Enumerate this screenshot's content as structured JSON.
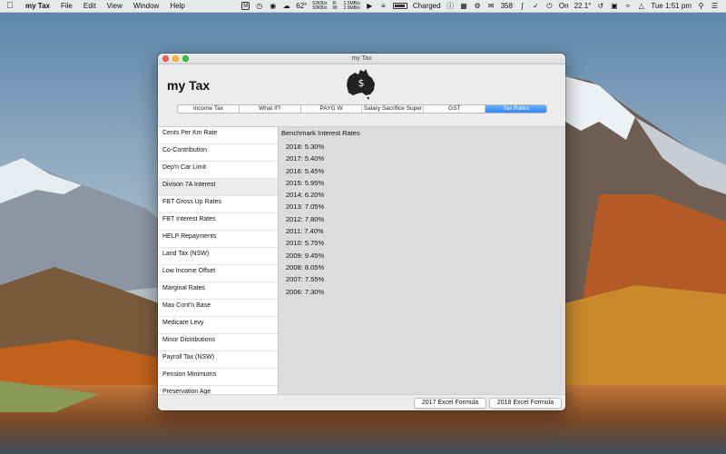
{
  "menubar": {
    "app_name": "my Tax",
    "menus": [
      "File",
      "Edit",
      "View",
      "Window",
      "Help"
    ],
    "temperature": "62°",
    "net_up": "52KB/s",
    "net_down": "50KB/s",
    "net_r_label": "R:",
    "net_w_label": "W:",
    "disk_r": "1.5MB/s",
    "disk_w": "2.9MB/s",
    "battery_status": "Charged",
    "mail_count": "358",
    "on_label": "On",
    "cpu_temp": "22.1°",
    "clock": "Tue 1:51 pm"
  },
  "window": {
    "title": "my Tax",
    "app_heading": "my Tax",
    "logo_symbol": "$",
    "tabs": [
      {
        "label": "Income Tax",
        "active": false
      },
      {
        "label": "What If?",
        "active": false
      },
      {
        "label": "PAYG W",
        "active": false
      },
      {
        "label": "Salary Sacrifice Super",
        "active": false
      },
      {
        "label": "GST",
        "active": false
      },
      {
        "label": "Tax Rates",
        "active": true
      }
    ],
    "sidebar_items": [
      "Cents Per Km Rate",
      "Co-Contribution",
      "Dep'n Car Limit",
      "Divison 7A Interest",
      "FBT Gross Up Rates",
      "FBT Interest Rates",
      "HELP Repayments",
      "Land Tax (NSW)",
      "Low Income Offset",
      "Marginal Rates",
      "Max Cont'n Base",
      "Medicare Levy",
      "Minor Distributions",
      "Payroll Tax (NSW)",
      "Pension Minimums",
      "Preservation Age"
    ],
    "selected_sidebar_index": 3,
    "main_title": "Benchmark Interest Rates",
    "rates": [
      "2018: 5.30%",
      "2017: 5.40%",
      "2016: 5.45%",
      "2015: 5.95%",
      "2014: 6.20%",
      "2013: 7.05%",
      "2012: 7.80%",
      "2011: 7.40%",
      "2010: 5.75%",
      "2009: 9.45%",
      "2008: 8.05%",
      "2007: 7.55%",
      "2006: 7.30%"
    ],
    "buttons": {
      "excel_2017": "2017 Excel Formula",
      "excel_2018": "2018 Excel Formula"
    }
  },
  "colors": {
    "tab_active": "#2f86f6",
    "close": "#fc5f57",
    "minimize": "#fdbc2e",
    "zoom": "#29c841"
  }
}
